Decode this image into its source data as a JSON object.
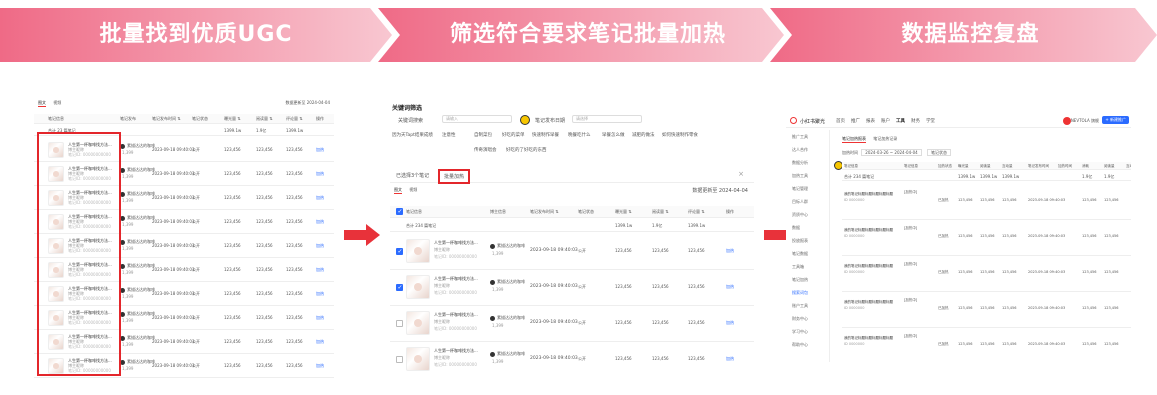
{
  "banner": {
    "step1": "批量找到优质UGC",
    "step2": "筛选符合要求笔记批量加热",
    "step3": "数据监控复盘",
    "colors": {
      "pink": "#ef7f96",
      "light": "#f7c4cf",
      "white_text": "#ffffff"
    }
  },
  "arrow_color": "#e8323a",
  "panel1": {
    "tabs": [
      "图文",
      "视频"
    ],
    "top_right": "数据更新至 2024-04-04",
    "headers": [
      "笔记信息",
      "笔记发布",
      "笔记发布时间 ⇅",
      "笔记状态",
      "曝光量 ⇅",
      "阅读量 ⇅",
      "评论量 ⇅",
      "操作"
    ],
    "summary": {
      "label": "合计 23 篇笔记",
      "v1": "1399.1w",
      "v2": "1.9亿",
      "v3": "1399.1w"
    },
    "rows": [
      {
        "title": "人生第一杯咖啡找方法...",
        "sub": "博主昵称",
        "id": "笔记ID: 00000000000",
        "author": "素描达达的咖啡",
        "fans": "1,399",
        "time": "2023-09-18 09:40:03",
        "status": "公开",
        "imp": "123,456",
        "read": "123,456",
        "cmt": "123,456",
        "op": "加热"
      },
      {
        "title": "人生第一杯咖啡找方法...",
        "sub": "博主昵称",
        "id": "笔记ID: 00000000000",
        "author": "素描达达的咖啡",
        "fans": "1,399",
        "time": "2023-09-18 09:40:03",
        "status": "公开",
        "imp": "123,456",
        "read": "123,456",
        "cmt": "123,456",
        "op": "加热"
      },
      {
        "title": "人生第一杯咖啡找方法...",
        "sub": "博主昵称",
        "id": "笔记ID: 00000000000",
        "author": "素描达达的咖啡",
        "fans": "1,399",
        "time": "2023-09-18 09:40:03",
        "status": "公开",
        "imp": "123,456",
        "read": "123,456",
        "cmt": "123,456",
        "op": "加热"
      },
      {
        "title": "人生第一杯咖啡找方法...",
        "sub": "博主昵称",
        "id": "笔记ID: 00000000000",
        "author": "素描达达的咖啡",
        "fans": "1,399",
        "time": "2023-09-18 09:40:03",
        "status": "公开",
        "imp": "123,456",
        "read": "123,456",
        "cmt": "123,456",
        "op": "加热"
      },
      {
        "title": "人生第一杯咖啡找方法...",
        "sub": "博主昵称",
        "id": "笔记ID: 00000000000",
        "author": "素描达达的咖啡",
        "fans": "1,399",
        "time": "2023-09-18 09:40:03",
        "status": "公开",
        "imp": "123,456",
        "read": "123,456",
        "cmt": "123,456",
        "op": "加热"
      },
      {
        "title": "人生第一杯咖啡找方法...",
        "sub": "博主昵称",
        "id": "笔记ID: 00000000000",
        "author": "素描达达的咖啡",
        "fans": "1,399",
        "time": "2023-09-18 09:40:03",
        "status": "公开",
        "imp": "123,456",
        "read": "123,456",
        "cmt": "123,456",
        "op": "加热"
      },
      {
        "title": "人生第一杯咖啡找方法...",
        "sub": "博主昵称",
        "id": "笔记ID: 00000000000",
        "author": "素描达达的咖啡",
        "fans": "1,399",
        "time": "2023-09-18 09:40:03",
        "status": "公开",
        "imp": "123,456",
        "read": "123,456",
        "cmt": "123,456",
        "op": "加热"
      },
      {
        "title": "人生第一杯咖啡找方法...",
        "sub": "博主昵称",
        "id": "笔记ID: 00000000000",
        "author": "素描达达的咖啡",
        "fans": "1,399",
        "time": "2023-09-18 09:40:03",
        "status": "公开",
        "imp": "123,456",
        "read": "123,456",
        "cmt": "123,456",
        "op": "加热"
      },
      {
        "title": "人生第一杯咖啡找方法...",
        "sub": "博主昵称",
        "id": "笔记ID: 00000000000",
        "author": "素描达达的咖啡",
        "fans": "1,399",
        "time": "2023-09-18 09:40:03",
        "status": "公开",
        "imp": "123,456",
        "read": "123,456",
        "cmt": "123,456",
        "op": "加热"
      },
      {
        "title": "人生第一杯咖啡找方法...",
        "sub": "博主昵称",
        "id": "笔记ID: 00000000000",
        "author": "素描达达的咖啡",
        "fans": "1,399",
        "time": "2023-09-18 09:40:03",
        "status": "公开",
        "imp": "123,456",
        "read": "123,456",
        "cmt": "123,456",
        "op": "加热"
      }
    ]
  },
  "panel2": {
    "title": "关键词筛选",
    "kw_label": "关键词搜索",
    "kw_placeholder": "请输入",
    "date_label": "笔记发布日期",
    "date_placeholder": "请选择",
    "tags1": [
      "因为天Tapt结果成绩",
      "注意性",
      "自制菜包",
      "好吃的菜单",
      "快速制作早餐",
      "晚餐吃什么",
      "早餐怎么做",
      "减肥的做法",
      "如何快速制作零食"
    ],
    "tags2": [
      "传奇演唱会",
      "好吃的了好吃的东西"
    ],
    "selected_text": "已选择3个笔记",
    "bulk_button": "批量加热",
    "close": "×",
    "tabs": [
      "图文",
      "视频"
    ],
    "top_right": "数据更新至 2024-04-04",
    "headers": [
      "笔记信息",
      "博主信息",
      "笔记发布时间 ⇅",
      "笔记状态",
      "曝光量 ⇅",
      "阅读量 ⇅",
      "评论量 ⇅",
      "操作"
    ],
    "summary": {
      "label": "合计 234 篇笔记",
      "v1": "1399.1w",
      "v2": "1.9亿",
      "v3": "1399.1w"
    },
    "rows": [
      {
        "checked": true,
        "title": "人生第一杯咖啡找方法...",
        "sub": "博主昵称",
        "id": "笔记ID: 00000000000",
        "author": "素描达达的咖啡",
        "fans": "1,399",
        "time": "2023-09-18 09:40:03",
        "status": "公开",
        "imp": "123,456",
        "read": "123,456",
        "cmt": "123,456",
        "op": "加热"
      },
      {
        "checked": true,
        "title": "人生第一杯咖啡找方法...",
        "sub": "博主昵称",
        "id": "笔记ID: 00000000000",
        "author": "素描达达的咖啡",
        "fans": "1,399",
        "time": "2023-09-18 09:40:03",
        "status": "公开",
        "imp": "123,456",
        "read": "123,456",
        "cmt": "123,456",
        "op": "加热"
      },
      {
        "checked": false,
        "title": "人生第一杯咖啡找方法...",
        "sub": "博主昵称",
        "id": "笔记ID: 00000000000",
        "author": "素描达达的咖啡",
        "fans": "1,399",
        "time": "2023-09-18 09:40:03",
        "status": "公开",
        "imp": "123,456",
        "read": "123,456",
        "cmt": "123,456",
        "op": "加热"
      },
      {
        "checked": false,
        "title": "人生第一杯咖啡找方法...",
        "sub": "博主昵称",
        "id": "笔记ID: 00000000000",
        "author": "素描达达的咖啡",
        "fans": "1,399",
        "time": "2023-09-18 09:40:03",
        "status": "公开",
        "imp": "123,456",
        "read": "123,456",
        "cmt": "123,456",
        "op": "加热"
      }
    ]
  },
  "panel3": {
    "logo": "小红书聚光",
    "nav": [
      "首页",
      "推广",
      "报表",
      "账户",
      "工具",
      "财务",
      "学堂"
    ],
    "nav_active": "工具",
    "user": "NEVTOLA 旗舰",
    "new_button": "+ 新建推广",
    "side": [
      "推广工具",
      "达人合作",
      "数据分析",
      "加热工具",
      "笔记管理",
      "目标人群",
      "资质中心",
      "数据",
      "投放报表",
      "笔记数据",
      "工具箱",
      "笔记加热",
      "搜索词包",
      "账户工具",
      "财务中心",
      "学习中心",
      "帮助中心"
    ],
    "tabs": [
      "笔记加热报表",
      "笔记加热记录"
    ],
    "filter_date_label": "加热时间",
    "filter_date": "2024-03-26 ~ 2024-04-04",
    "filter_status": "笔记状态",
    "headers": [
      "笔记信息",
      "笔记信息",
      "加热状态",
      "曝光量",
      "阅读量",
      "互动量",
      "笔记发布时间",
      "加热时间",
      "消耗",
      "阅读量",
      "互动量",
      "操作"
    ],
    "summary": {
      "label": "合计 234 篇笔记",
      "v1": "1399.1w",
      "v2": "1399.1w",
      "v3": "1399.1w",
      "v4": "1.9亿",
      "v5": "1.9亿"
    },
    "rows": [
      {
        "title": "我的笔记标题标题标题标题标题",
        "sub": "ID 0000000",
        "type": "[加热中]",
        "time": "2023-09-18 09:40:03",
        "status": "已加热",
        "val": "123,456",
        "ops": [
          "查看详情",
          "数据报表",
          "停止加热"
        ]
      },
      {
        "title": "我的笔记标题标题标题标题标题",
        "sub": "ID 0000000",
        "type": "[加热中]",
        "time": "2023-09-18 09:40:03",
        "status": "已加热",
        "val": "123,456",
        "ops": [
          "查看详情",
          "数据报表",
          "停止加热"
        ]
      },
      {
        "title": "我的笔记标题标题标题标题标题",
        "sub": "ID 0000000",
        "type": "[加热中]",
        "time": "2023-09-18 09:40:03",
        "status": "已加热",
        "val": "123,456",
        "ops": [
          "查看详情",
          "数据报表",
          "停止加热"
        ]
      },
      {
        "title": "我的笔记标题标题标题标题标题",
        "sub": "ID 0000000",
        "type": "[加热中]",
        "time": "2023-09-18 09:40:03",
        "status": "已加热",
        "val": "123,456",
        "ops": [
          "查看详情",
          "数据报表",
          "停止加热"
        ]
      },
      {
        "title": "我的笔记标题标题标题标题标题",
        "sub": "ID 0000000",
        "type": "[加热中]",
        "time": "2023-09-18 09:40:03",
        "status": "已加热",
        "val": "123,456",
        "ops": [
          "查看详情",
          "数据报表",
          "停止加热"
        ]
      }
    ]
  }
}
